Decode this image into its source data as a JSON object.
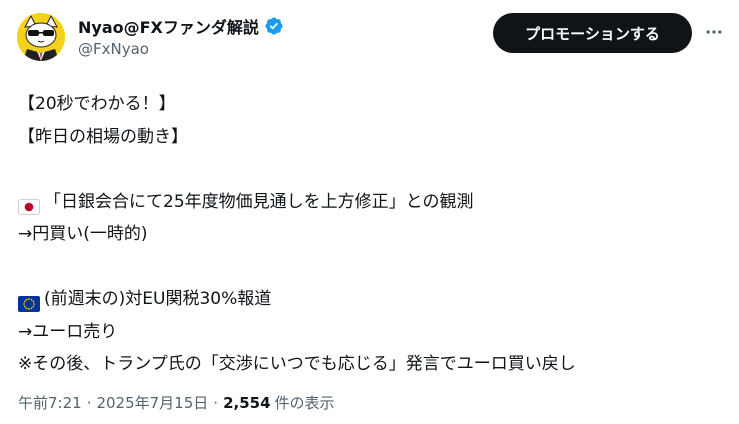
{
  "author": {
    "display_name": "Nyao@FXファンダ解説",
    "handle": "@FxNyao",
    "avatar_icon": "cat-avatar-icon",
    "verified_icon": "verified-badge-icon"
  },
  "header": {
    "promote_label": "プロモーションする",
    "more_icon": "more-horizontal-icon"
  },
  "tweet": {
    "lines": [
      "【20秒でわかる！】",
      "【昨日の相場の動き】",
      "",
      "「日銀会合にて25年度物価見通しを上方修正」との観測",
      "→円買い(一時的)",
      "",
      "(前週末の)対EU関税30%報道",
      "→ユーロ売り",
      "※その後、トランプ氏の「交渉にいつでも応じる」発言でユーロ買い戻し"
    ],
    "flags": {
      "japan": "japan-flag-icon",
      "eu": "eu-flag-icon"
    }
  },
  "meta": {
    "time": "午前7:21",
    "separator": "·",
    "date": "2025年7月15日",
    "views_count": "2,554",
    "views_label": "件の表示"
  },
  "colors": {
    "text_primary": "#0f1419",
    "text_secondary": "#536471",
    "verified_blue": "#1d9bf0",
    "button_bg": "#0f1419",
    "avatar_yellow": "#f4d21c",
    "eu_blue": "#003399",
    "japan_red": "#bc002d"
  }
}
